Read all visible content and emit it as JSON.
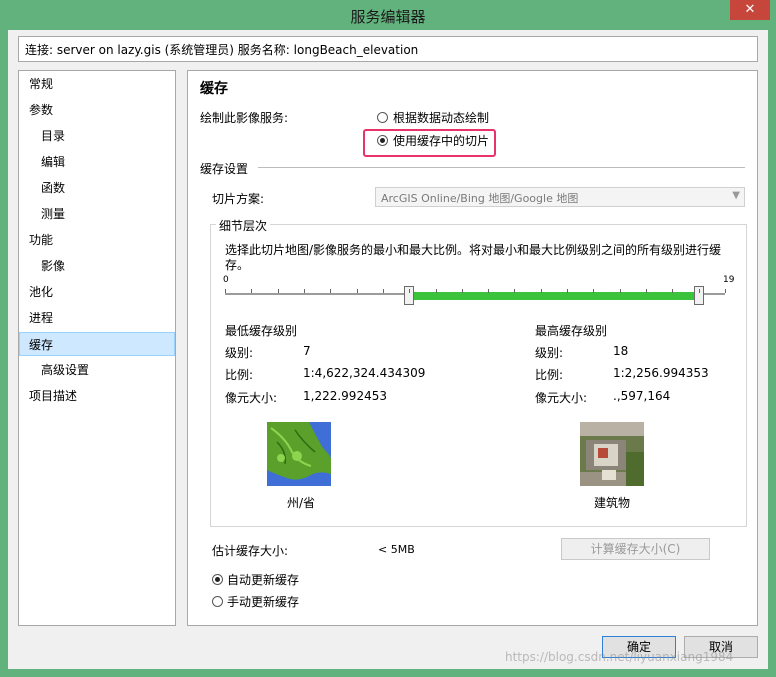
{
  "window": {
    "title": "服务编辑器",
    "close_glyph": "✕"
  },
  "connection": {
    "text": "连接: server on lazy.gis (系统管理员)   服务名称: longBeach_elevation"
  },
  "sidebar": {
    "items": [
      {
        "label": "常规"
      },
      {
        "label": "参数"
      },
      {
        "label": "目录"
      },
      {
        "label": "编辑"
      },
      {
        "label": "函数"
      },
      {
        "label": "测量"
      },
      {
        "label": "功能"
      },
      {
        "label": "影像"
      },
      {
        "label": "池化"
      },
      {
        "label": "进程"
      },
      {
        "label": "缓存"
      },
      {
        "label": "高级设置"
      },
      {
        "label": "项目描述"
      }
    ]
  },
  "main": {
    "heading": "缓存",
    "draw_label": "绘制此影像服务:",
    "radio_dynamic": "根据数据动态绘制",
    "radio_cache": "使用缓存中的切片",
    "cache_settings": "缓存设置",
    "tiling_label": "切片方案:",
    "tiling_value": "ArcGIS Online/Bing 地图/Google 地图",
    "lod": {
      "title": "细节层次",
      "description": "选择此切片地图/影像服务的最小和最大比例。将对最小和最大比例级别之间的所有级别进行缓存。",
      "slider_min_label": "0",
      "slider_max_label": "19",
      "min_level": 7,
      "max_level": 18,
      "left": {
        "title": "最低缓存级别",
        "level_label": "级别:",
        "level_value": "7",
        "scale_label": "比例:",
        "scale_value": "1:4,622,324.434309",
        "pixel_label": "像元大小:",
        "pixel_value": "1,222.992453",
        "thumb_caption": "州/省"
      },
      "right": {
        "title": "最高缓存级别",
        "level_label": "级别:",
        "level_value": "18",
        "scale_label": "比例:",
        "scale_value": "1:2,256.994353",
        "pixel_label": "像元大小:",
        "pixel_value": ".,597,164",
        "thumb_caption": "建筑物"
      }
    },
    "estimate_label": "估计缓存大小:",
    "estimate_value": "< 5MB",
    "calc_button": "计算缓存大小(C)",
    "auto_update": "自动更新缓存",
    "manual_update": "手动更新缓存"
  },
  "footer": {
    "ok": "确定",
    "cancel": "取消"
  },
  "watermark": "https://blog.csdn.net/liyuanxiang1984"
}
